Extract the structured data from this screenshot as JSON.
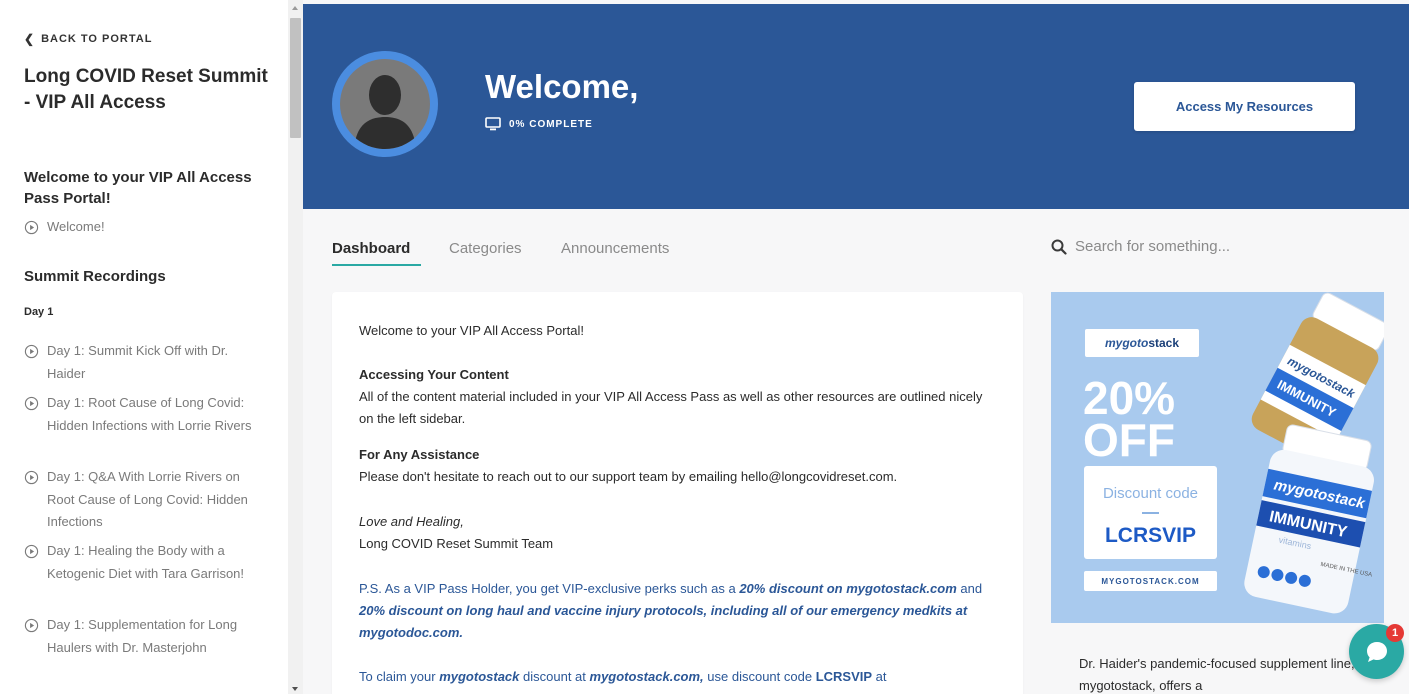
{
  "sidebar": {
    "back_label": "BACK TO PORTAL",
    "course_title": "Long COVID Reset Summit - VIP All Access",
    "sections": [
      {
        "title": "Welcome to your VIP All Access Pass Portal!",
        "lessons": [
          "Welcome!"
        ]
      },
      {
        "title": "Summit Recordings",
        "day_label": "Day 1",
        "lessons": [
          "Day 1: Summit Kick Off with Dr. Haider",
          "Day 1: Root Cause of Long Covid: Hidden Infections with Lorrie Rivers",
          "Day 1: Q&A With Lorrie Rivers on Root Cause of Long Covid: Hidden Infections",
          "Day 1: Healing the Body with a Ketogenic Diet with Tara Garrison!",
          "Day 1: Supplementation for Long Haulers with Dr. Masterjohn"
        ]
      }
    ]
  },
  "header": {
    "welcome": "Welcome,",
    "progress_label": "0% COMPLETE",
    "progress_percent": 0,
    "access_button": "Access My Resources"
  },
  "tabs": [
    {
      "label": "Dashboard",
      "active": true
    },
    {
      "label": "Categories",
      "active": false
    },
    {
      "label": "Announcements",
      "active": false
    }
  ],
  "search": {
    "placeholder": "Search for something..."
  },
  "content": {
    "intro": "Welcome to your VIP All Access Portal!",
    "h1": "Accessing Your Content",
    "p1": "All of the content material included in your VIP All Access Pass as well as other resources are outlined nicely on the left sidebar.",
    "h2": "For Any Assistance",
    "p2": "Please don't hesitate to reach out to our support team by emailing hello@longcovidreset.com.",
    "signoff": "Love and Healing,",
    "team": "Long COVID Reset Summit Team",
    "ps": {
      "a": "P.S. As a VIP Pass Holder, you get VIP-exclusive perks such as a ",
      "b": "20% discount on mygotostack.com",
      "c": " and ",
      "d": "20% discount on long haul and vaccine injury protocols, including all of our emergency medkits at mygotodoc.com."
    },
    "claim": {
      "a": "To claim your ",
      "b": "mygotostack",
      "c": " discount at ",
      "d": "mygotostack.com,",
      "e": " use discount code ",
      "f": "LCRSVIP",
      "g": " at"
    }
  },
  "ad": {
    "logo_a": "mygoto",
    "logo_b": "stack",
    "percent": "20%",
    "off": "OFF",
    "code_label": "Discount code",
    "code": "LCRSVIP",
    "url": "MYGOTOSTACK.COM",
    "bottle1_brand": "mygotostack",
    "bottle1_word": "IMMUNITY",
    "bottle2_brand": "mygotostack",
    "bottle2_word": "IMMUNITY",
    "bottle2_sub": "vitamins",
    "made_in": "MADE IN THE USA"
  },
  "ad_text": "Dr. Haider's pandemic-focused supplement line, mygotostack, offers a",
  "chat": {
    "badge": "1"
  },
  "colors": {
    "header": "#2b5797",
    "accent": "#2aa9a4",
    "ad_bg": "#a9caee",
    "link_blue": "#2b5797"
  }
}
